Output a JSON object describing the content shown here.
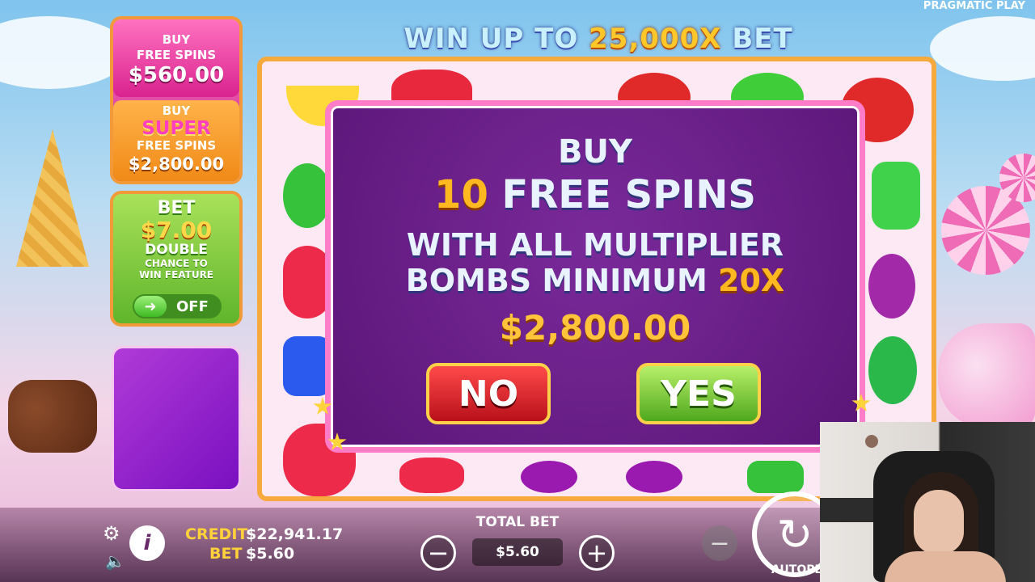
{
  "brand": "PRAGMATIC PLAY",
  "banner": {
    "prefix": "WIN UP TO ",
    "amount": "25,000X",
    "suffix": " BET"
  },
  "buy_free_spins": {
    "line1": "BUY",
    "line2": "FREE SPINS",
    "price": "$560.00"
  },
  "buy_super": {
    "line1": "BUY",
    "line2": "SUPER",
    "line3": "FREE SPINS",
    "price": "$2,800.00"
  },
  "bet_feature": {
    "title": "BET",
    "price": "$7.00",
    "double": "DOUBLE",
    "desc1": "CHANCE TO",
    "desc2": "WIN FEATURE",
    "toggle_state": "OFF",
    "toggle_arrow": "➜"
  },
  "modal": {
    "line1": "BUY",
    "line2_num": "10",
    "line2_text": " FREE SPINS",
    "line3": "WITH ALL MULTIPLIER",
    "line4_text": "BOMBS MINIMUM ",
    "line4_mult": "20X",
    "price": "$2,800.00",
    "no_label": "NO",
    "yes_label": "YES"
  },
  "bottom": {
    "credit_label": "CREDIT",
    "credit_value": "$22,941.17",
    "bet_label": "BET",
    "bet_value": "$5.60",
    "total_bet_label": "TOTAL BET",
    "total_bet_value": "$5.60",
    "minus": "−",
    "plus": "+",
    "info": "i",
    "gear": "⚙",
    "speaker": "🔈",
    "spin": "↻",
    "autoplay": "AUTOPLA"
  },
  "colors": {
    "accent_gold": "#ffc72a",
    "modal_bg": "#5a1577",
    "no_red": "#b8101a",
    "yes_green": "#4fa81c"
  }
}
